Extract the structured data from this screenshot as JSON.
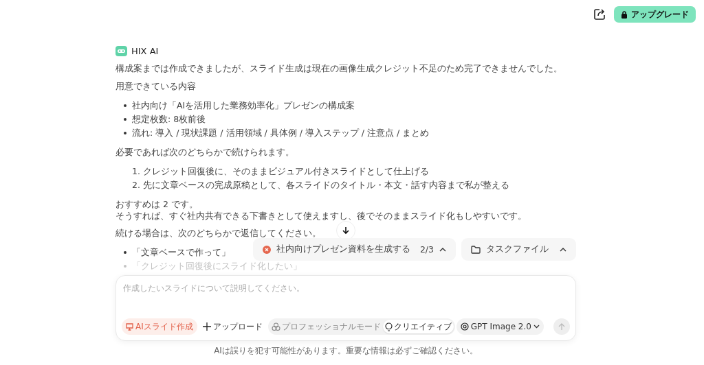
{
  "header": {
    "upgrade_label": "アップグレード"
  },
  "message": {
    "author": "HIX AI",
    "intro": "構成案までは作成できましたが、スライド生成は現在の画像生成クレジット不足のため完了できませんでした。",
    "ready_heading": "用意できている内容",
    "ready_items": [
      "社内向け「AIを活用した業務効率化」プレゼンの構成案",
      "想定枚数: 8枚前後",
      "流れ: 導入 / 現状課題 / 活用領域 / 具体例 / 導入ステップ / 注意点 / まとめ"
    ],
    "options_heading": "必要であれば次のどちらかで続けられます。",
    "options": [
      {
        "number": "1.",
        "text": "クレジット回復後に、そのままビジュアル付きスライドとして仕上げる"
      },
      {
        "number": "2.",
        "text": "先に文章ベースの完成原稿として、各スライドのタイトル・本文・話す内容まで私が整える"
      }
    ],
    "recommend": [
      "おすすめは 2 です。",
      "そうすれば、すぐ社内共有できる下書きとして使えますし、後でそのままスライド化もしやすいです。"
    ],
    "reply_heading": "続ける場合は、次のどちらかで返信してください。",
    "reply_items": [
      "「文章ベースで作って」",
      "「クレジット回復後にスライド化したい」"
    ]
  },
  "task_bar": {
    "task": {
      "label": "社内向けプレゼン資料を生成する",
      "progress": "2/3"
    },
    "files": {
      "label": "タスクファイル"
    }
  },
  "composer": {
    "placeholder": "作成したいスライドについて説明してください。",
    "tool": "AIスライド作成",
    "upload": "アップロード",
    "modes": [
      {
        "label": "プロフェッショナルモード",
        "selected": false
      },
      {
        "label": "クリエイティブ",
        "selected": true
      }
    ],
    "model": "GPT Image 2.0"
  },
  "footer": "AIは誤りを犯す可能性があります。重要な情報は必ずご確認ください。"
}
